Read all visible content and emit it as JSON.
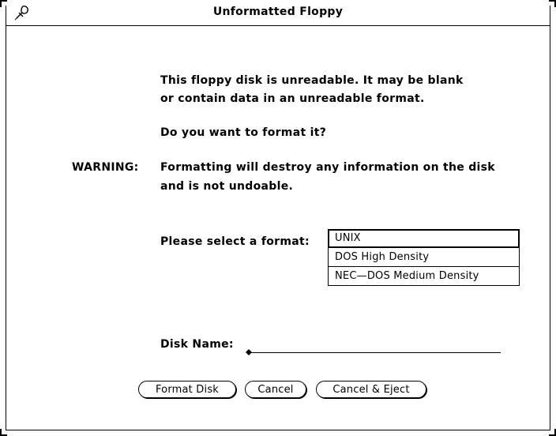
{
  "window": {
    "title": "Unformatted Floppy",
    "menu_icon": "pushpin-menu-icon"
  },
  "message": {
    "line1": "This floppy disk is unreadable.  It may be blank",
    "line2": "or contain data in an unreadable format.",
    "question": "Do you want to format it?",
    "warning_label": "WARNING:",
    "warning_line1": "Formatting will destroy any information on the disk",
    "warning_line2": "and is not undoable."
  },
  "format": {
    "label": "Please select a format:",
    "options": [
      "UNIX",
      "DOS High Density",
      "NEC—DOS Medium Density"
    ],
    "selected": "UNIX"
  },
  "disk_name": {
    "label": "Disk Name:",
    "value": ""
  },
  "buttons": {
    "format": "Format Disk",
    "cancel": "Cancel",
    "cancel_eject": "Cancel & Eject"
  }
}
